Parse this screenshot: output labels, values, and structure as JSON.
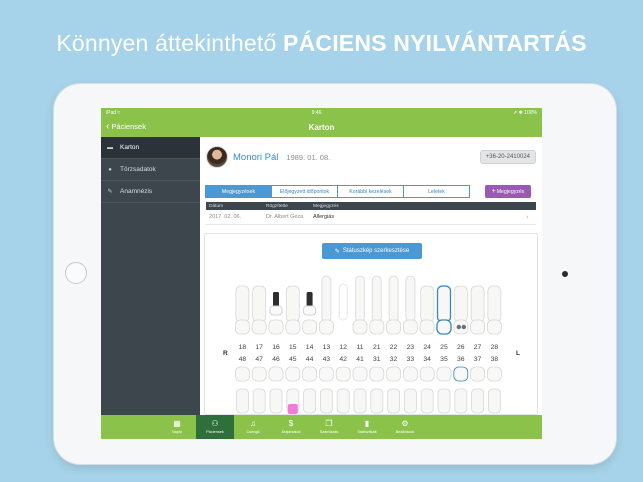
{
  "headline": {
    "light": "Könnyen áttekinthető ",
    "bold": "PÁCIENS NYILVÁNTARTÁS"
  },
  "statusbar": {
    "carrier": "iPad ≈",
    "time": "9:46",
    "battery": "➚ ✱ 100%"
  },
  "navbar": {
    "back_label": "Páciensek",
    "title": "Karton"
  },
  "sidebar": {
    "items": [
      {
        "label": "Karton",
        "icon": "card-icon"
      },
      {
        "label": "Törzsadatok",
        "icon": "person-icon"
      },
      {
        "label": "Anamnézis",
        "icon": "notes-icon"
      }
    ]
  },
  "patient": {
    "name": "Monori Pál",
    "dob": "1989. 01. 08.",
    "phone": "+36-20-2410024"
  },
  "tabs": [
    "Megjegyzések",
    "Előjegyzett időpontok",
    "Korábbi kezelések",
    "Leletek"
  ],
  "add_note_label": "Megjegyzés",
  "table": {
    "headers": [
      "Dátum",
      "Rögzítette",
      "Megjegyzés"
    ],
    "rows": [
      {
        "date": "2017. 02. 06.",
        "by": "Dr. Albert Géza",
        "note": "Allergiás"
      }
    ]
  },
  "odontogram": {
    "status_button": "Státuszkép szerkesztése",
    "right_label": "R",
    "left_label": "L",
    "upper_numbers": [
      "18",
      "17",
      "16",
      "15",
      "14",
      "13",
      "12",
      "11",
      "21",
      "22",
      "23",
      "24",
      "25",
      "26",
      "27",
      "28"
    ],
    "lower_numbers": [
      "48",
      "47",
      "46",
      "45",
      "44",
      "43",
      "42",
      "41",
      "31",
      "32",
      "33",
      "34",
      "35",
      "36",
      "37",
      "38"
    ]
  },
  "tabbar": {
    "items": [
      {
        "label": "Napló",
        "icon": "calendar-icon"
      },
      {
        "label": "Páciensek",
        "icon": "user-icon"
      },
      {
        "label": "Csengő",
        "icon": "bell-icon"
      },
      {
        "label": "Árajánlatok",
        "icon": "dollar-icon"
      },
      {
        "label": "Számlázás",
        "icon": "documents-icon"
      },
      {
        "label": "Statisztikák",
        "icon": "bar-chart-icon"
      },
      {
        "label": "Beállítások",
        "icon": "gear-icon"
      }
    ]
  },
  "colors": {
    "brand_green": "#8bc34a",
    "accent_blue": "#4a98d4",
    "sidebar_dark": "#3d464d",
    "purple": "#9b59b6",
    "background": "#a6d3e9"
  }
}
